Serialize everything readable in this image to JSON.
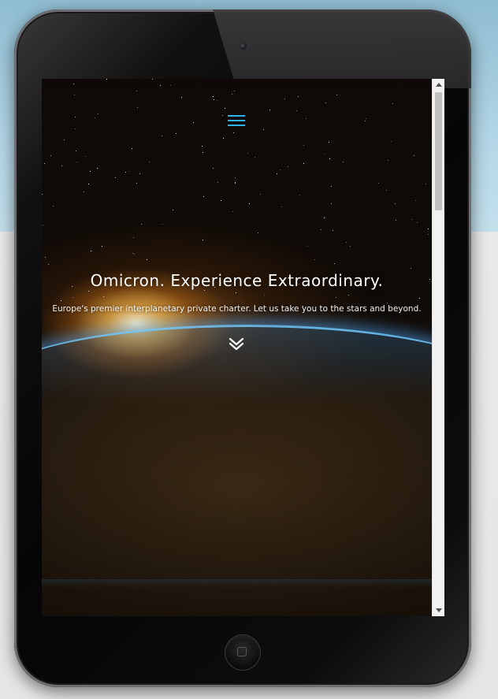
{
  "device": {
    "type": "tablet",
    "camera_icon": "camera-icon",
    "home_button_icon": "home-button-icon"
  },
  "header": {
    "menu_icon": "hamburger-menu-icon",
    "menu_color": "#2fb3e6"
  },
  "hero": {
    "title": "Omicron. Experience Extraordinary.",
    "subtitle": "Europe's premier interplanetary private charter. Let us take you to the stars and beyond.",
    "scroll_icon": "double-chevron-down-icon"
  },
  "scrollbar": {
    "up_icon": "scroll-up-arrow-icon",
    "down_icon": "scroll-down-arrow-icon"
  }
}
